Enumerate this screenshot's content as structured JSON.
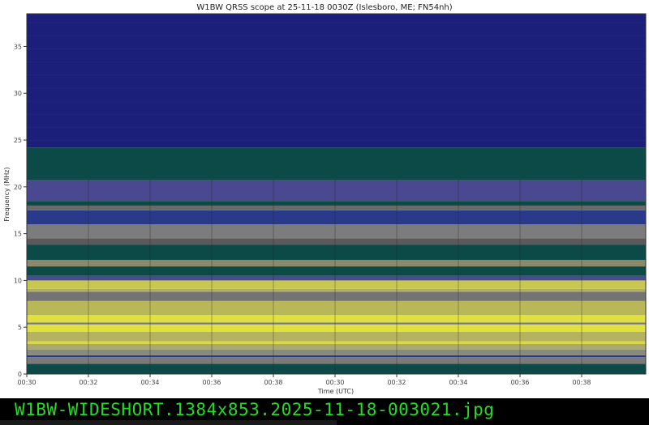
{
  "chart_data": {
    "type": "heatmap",
    "title": "W1BW QRSS scope at 25-11-18 0030Z (Islesboro, ME; FN54nh)",
    "xlabel": "Time (UTC)",
    "ylabel": "Frequency (MHz)",
    "ylim": [
      0,
      38.5
    ],
    "yticks": [
      "0",
      "5",
      "10",
      "15",
      "20",
      "25",
      "30",
      "35"
    ],
    "xticks": [
      "00:30",
      "00:32",
      "00:34",
      "00:36",
      "00:38",
      "00:30",
      "00:32",
      "00:34",
      "00:36",
      "00:38"
    ],
    "grid": false,
    "bands_mhz": [
      {
        "from": 0,
        "to": 1.1,
        "color": "#0b4a47"
      },
      {
        "from": 1.1,
        "to": 1.8,
        "color": "#7a7a7a"
      },
      {
        "from": 1.8,
        "to": 2.0,
        "color": "#2a3a8a"
      },
      {
        "from": 2.0,
        "to": 2.6,
        "color": "#8a8a7a"
      },
      {
        "from": 2.6,
        "to": 3.2,
        "color": "#a8a870"
      },
      {
        "from": 3.2,
        "to": 3.5,
        "color": "#d8d848"
      },
      {
        "from": 3.5,
        "to": 4.5,
        "color": "#b4b460"
      },
      {
        "from": 4.5,
        "to": 5.3,
        "color": "#e0e040"
      },
      {
        "from": 5.3,
        "to": 5.5,
        "color": "#7a7a7a"
      },
      {
        "from": 5.5,
        "to": 6.3,
        "color": "#e0e040"
      },
      {
        "from": 6.3,
        "to": 7.8,
        "color": "#b8b858"
      },
      {
        "from": 7.8,
        "to": 8.8,
        "color": "#747474"
      },
      {
        "from": 8.8,
        "to": 9.1,
        "color": "#b0b060"
      },
      {
        "from": 9.1,
        "to": 10.0,
        "color": "#c8c850"
      },
      {
        "from": 10.0,
        "to": 10.5,
        "color": "#4a4a90"
      },
      {
        "from": 10.5,
        "to": 11.5,
        "color": "#0b4a47"
      },
      {
        "from": 11.5,
        "to": 12.2,
        "color": "#8a8a6a"
      },
      {
        "from": 12.2,
        "to": 13.8,
        "color": "#0b4a47"
      },
      {
        "from": 13.8,
        "to": 14.5,
        "color": "#5a5a5a"
      },
      {
        "from": 14.5,
        "to": 16.0,
        "color": "#7c7c7c"
      },
      {
        "from": 16.0,
        "to": 17.5,
        "color": "#2a3a8a"
      },
      {
        "from": 17.5,
        "to": 18.0,
        "color": "#6a6a6a"
      },
      {
        "from": 18.0,
        "to": 18.5,
        "color": "#0b4a47"
      },
      {
        "from": 18.5,
        "to": 20.7,
        "color": "#4a4890"
      },
      {
        "from": 20.7,
        "to": 24.2,
        "color": "#0b4a47"
      },
      {
        "from": 24.2,
        "to": 38.5,
        "color": "#1b1f7a"
      }
    ]
  },
  "footer": {
    "filename": "W1BW-WIDESHORT.1384x853.2025-11-18-003021.jpg"
  }
}
